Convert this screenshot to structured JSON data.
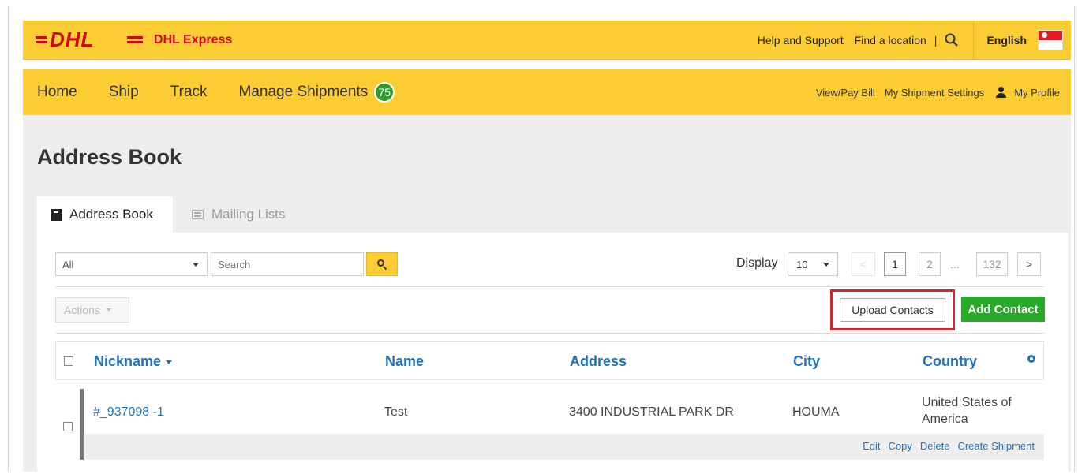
{
  "header": {
    "brand_title": "DHL Express",
    "links": {
      "help": "Help and Support",
      "find": "Find a location",
      "separator": "|"
    },
    "language": "English"
  },
  "nav": {
    "items": [
      "Home",
      "Ship",
      "Track",
      "Manage Shipments"
    ],
    "manage_badge": "75",
    "right": {
      "bill": "View/Pay Bill",
      "settings": "My Shipment Settings",
      "profile": "My Profile"
    }
  },
  "page": {
    "title": "Address Book"
  },
  "tabs": {
    "active": "Address Book",
    "other": "Mailing Lists"
  },
  "toolbar": {
    "filter_value": "All",
    "search_placeholder": "Search",
    "display_label": "Display",
    "display_value": "10",
    "pages": [
      "1",
      "2",
      "132"
    ],
    "ellipsis": "...",
    "prev": "<",
    "next": ">",
    "actions_label": "Actions",
    "upload_label": "Upload Contacts",
    "add_label": "Add Contact"
  },
  "table": {
    "headers": [
      "Nickname",
      "Name",
      "Address",
      "City",
      "Country"
    ],
    "rows": [
      {
        "nickname": "#_937098 -1",
        "name": "Test",
        "address": "3400 INDUSTRIAL PARK DR",
        "city": "HOUMA",
        "country_line1": "United States of",
        "country_line2": "America"
      }
    ],
    "row_actions": [
      "Edit",
      "Copy",
      "Delete",
      "Create Shipment"
    ]
  },
  "colors": {
    "brand_yellow": "#fccc33",
    "brand_red": "#d40511",
    "link_blue": "#2272b9",
    "add_green": "#2aa82a",
    "highlight_red": "#d3262e"
  }
}
